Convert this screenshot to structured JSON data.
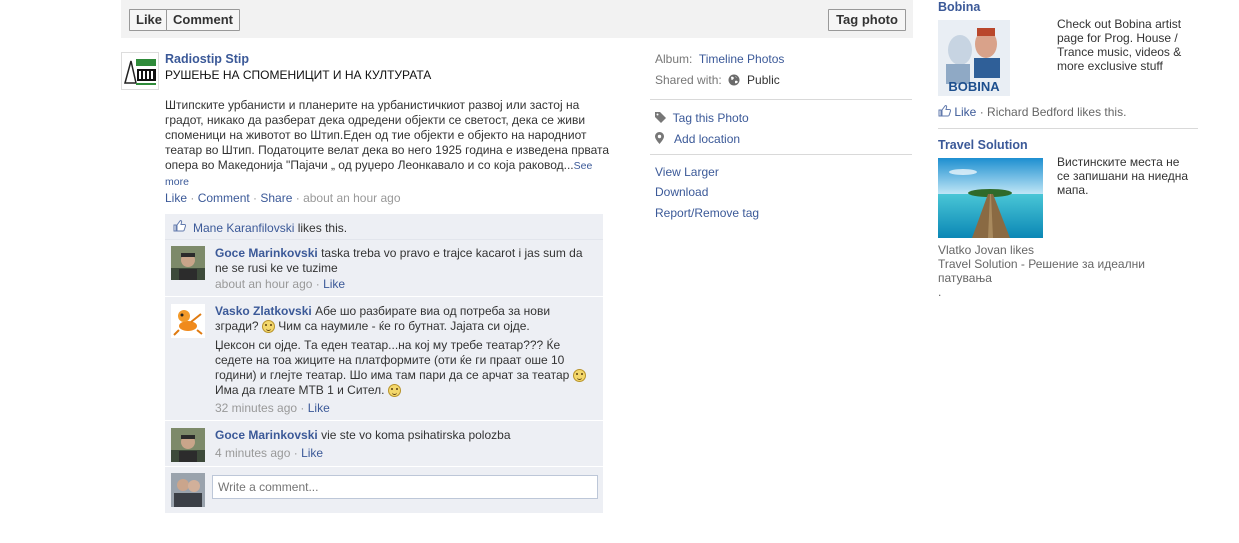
{
  "toolbar": {
    "like_label": "Like",
    "comment_label": "Comment",
    "tag_label": "Tag photo"
  },
  "post": {
    "author": "Radiostip Stip",
    "title": "РУШЕЊЕ НА СПОМЕНИЦИТ И НА КУЛТУРАТА",
    "body": "Штипските урбанисти и планерите на урбанистичкиот развој или застој на градот, никако да разберат дека одредени објекти се светост, дека се живи споменици на животот во Штип.Еден од тие објекти е објекто на народниот театар во Штип. Податоците велат дека во него 1925 година е изведена првата опера во Македонија \"Пајачи „ од руџеро Леонкавало и со која раковод...",
    "see_more": "See more",
    "actions": {
      "like": "Like",
      "comment": "Comment",
      "share": "Share",
      "time": "about an hour ago"
    }
  },
  "ufi": {
    "likes": {
      "name": "Mane Karanfilovski",
      "suffix": " likes this."
    },
    "comments": [
      {
        "author": "Goce Marinkovski",
        "text": "taska treba vo pravo e trajce kacarot i jas sum da ne se rusi ke ve tuzime",
        "time": "about an hour ago",
        "like": "Like"
      },
      {
        "author": "Vasko Zlatkovski",
        "text_a": "Абе шо разбирате виа од потреба за нови згради? ",
        "text_b": " Чим са наумиле - ќе го бутнат. Јајата си ојде.",
        "text_c": "Џексон си ојде. Та еден театар...на кој му требе театар??? Ќе седете на тоа жиците на платформите (оти ќе ги праат оше 10 години) и глејте театар. Шо има там пари да се арчат за театар ",
        "text_d": " Има да глеате МТВ 1 и Сител. ",
        "time": "32 minutes ago",
        "like": "Like"
      },
      {
        "author": "Goce Marinkovski",
        "text": "vie ste vo koma psihatirska polozba",
        "time": "4 minutes ago",
        "like": "Like"
      }
    ],
    "placeholder": "Write a comment..."
  },
  "meta": {
    "album_label": "Album:",
    "album_value": "Timeline Photos",
    "shared_label": "Shared with:",
    "shared_value": "Public",
    "tag_photo": "Tag this Photo",
    "add_location": "Add location",
    "view_larger": "View Larger",
    "download": "Download",
    "report": "Report/Remove tag"
  },
  "sidebar": {
    "ad1": {
      "title": "Bobina",
      "text": "Check out Bobina artist page for Prog. House / Trance music, videos & more exclusive stuff",
      "like": "Like",
      "social": "Richard Bedford likes this.",
      "image_word": "BOBINA"
    },
    "ad2": {
      "title": "Travel Solution",
      "text": "Вистинските места не се запишани на ниедна мапа.",
      "social_line1": "Vlatko Jovan likes",
      "social_line2": "Travel Solution - Решение за идеални патувања",
      "social_line3": "."
    }
  },
  "colors": {
    "link": "#3b5998",
    "ufi_bg": "#edeff4",
    "topbar_bg": "#f2f2f2"
  }
}
